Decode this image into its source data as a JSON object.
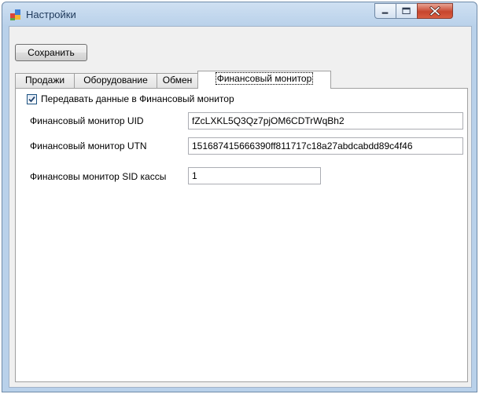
{
  "window": {
    "title": "Настройки"
  },
  "toolbar": {
    "save_label": "Сохранить"
  },
  "tabs": [
    {
      "label": "Продажи"
    },
    {
      "label": "Оборудование"
    },
    {
      "label": "Обмен"
    },
    {
      "label": "Финансовый монитор"
    }
  ],
  "panel": {
    "transmit_checkbox": {
      "label": "Передавать данные в Финансовый монитор",
      "checked": true
    },
    "fields": [
      {
        "label": "Финансовый монитор UID",
        "value": "fZcLXKL5Q3Qz7pjOM6CDTrWqBh2"
      },
      {
        "label": "Финансовый монитор UTN",
        "value": "151687415666390ff811717c18a27abdcabdd89c4f46"
      },
      {
        "label": "Финансовы монитор SID кассы",
        "value": "1"
      }
    ]
  }
}
